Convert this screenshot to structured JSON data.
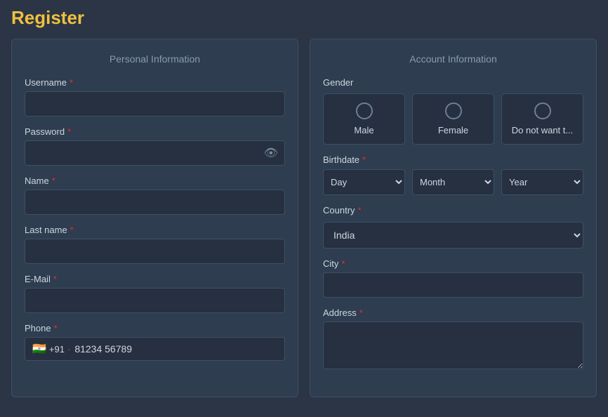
{
  "page": {
    "title": "Register"
  },
  "personal_panel": {
    "title": "Personal Information",
    "fields": {
      "username_label": "Username",
      "password_label": "Password",
      "name_label": "Name",
      "last_name_label": "Last name",
      "email_label": "E-Mail",
      "phone_label": "Phone",
      "phone_flag": "🇮🇳",
      "phone_code": "+91",
      "phone_separator": "·",
      "phone_value": "81234 56789"
    }
  },
  "account_panel": {
    "title": "Account Information",
    "gender": {
      "label": "Gender",
      "options": [
        {
          "value": "male",
          "label": "Male"
        },
        {
          "value": "female",
          "label": "Female"
        },
        {
          "value": "other",
          "label": "Do not want t..."
        }
      ]
    },
    "birthdate": {
      "label": "Birthdate",
      "day_placeholder": "Day",
      "month_placeholder": "Month",
      "year_placeholder": "Year"
    },
    "country": {
      "label": "Country",
      "selected": "India"
    },
    "city": {
      "label": "City"
    },
    "address": {
      "label": "Address"
    }
  },
  "icons": {
    "eye": "👁",
    "required": "*"
  }
}
